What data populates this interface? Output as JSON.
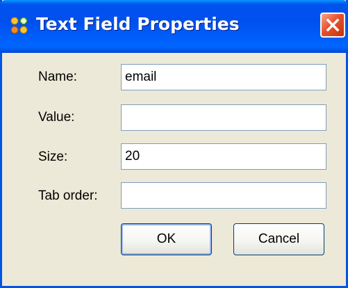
{
  "window": {
    "title": "Text Field Properties",
    "app_icon": "properties-icon",
    "close_icon": "close-icon"
  },
  "form": {
    "fields": [
      {
        "label": "Name:",
        "value": "email"
      },
      {
        "label": "Value:",
        "value": ""
      },
      {
        "label": "Size:",
        "value": "20"
      },
      {
        "label": "Tab order:",
        "value": ""
      }
    ]
  },
  "buttons": {
    "ok_label": "OK",
    "cancel_label": "Cancel"
  },
  "colors": {
    "titlebar": "#0054e3",
    "dialog_bg": "#ece9d8",
    "close_button": "#e0502a"
  }
}
